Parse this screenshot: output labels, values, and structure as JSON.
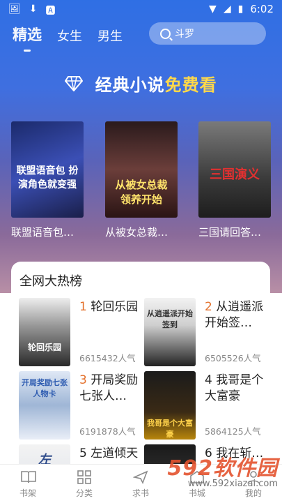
{
  "status": {
    "time": "6:02"
  },
  "tabs": [
    {
      "label": "精选"
    },
    {
      "label": "女生"
    },
    {
      "label": "男生"
    }
  ],
  "search": {
    "placeholder": "斗罗"
  },
  "banner": {
    "text_a": "经典小说",
    "text_b": "免费看"
  },
  "featured": [
    {
      "title": "联盟语音包…",
      "cover_text": "联盟语音包 扮演角色就变强"
    },
    {
      "title": "从被女总裁…",
      "cover_text": "从被女总裁 领养开始"
    },
    {
      "title": "三国请回答…",
      "cover_text": "三国演义"
    }
  ],
  "hot": {
    "title": "全网大热榜",
    "items": [
      {
        "num": "1",
        "name": "轮回乐园",
        "pop": "6615432人气",
        "cover_text": "轮回乐园"
      },
      {
        "num": "2",
        "name": "从逍遥派开始签…",
        "pop": "6505526人气",
        "cover_text": "从逍遥派开始签到"
      },
      {
        "num": "3",
        "name": "开局奖励七张人…",
        "pop": "6191878人气",
        "cover_text": "开局奖励七张人物卡"
      },
      {
        "num": "4",
        "name": "我哥是个大富豪",
        "pop": "5864125人气",
        "cover_text": "我哥是个大富豪"
      },
      {
        "num": "5",
        "name": "左道倾天",
        "pop": "",
        "cover_text": "左"
      },
      {
        "num": "6",
        "name": "我在斩…",
        "pop": "",
        "cover_text": ""
      }
    ]
  },
  "nav": [
    {
      "label": "书架"
    },
    {
      "label": "分类"
    },
    {
      "label": "求书"
    },
    {
      "label": "书城"
    },
    {
      "label": "我的"
    }
  ],
  "watermark": {
    "big": "592软件园",
    "small": "www.592xiazai.com"
  }
}
